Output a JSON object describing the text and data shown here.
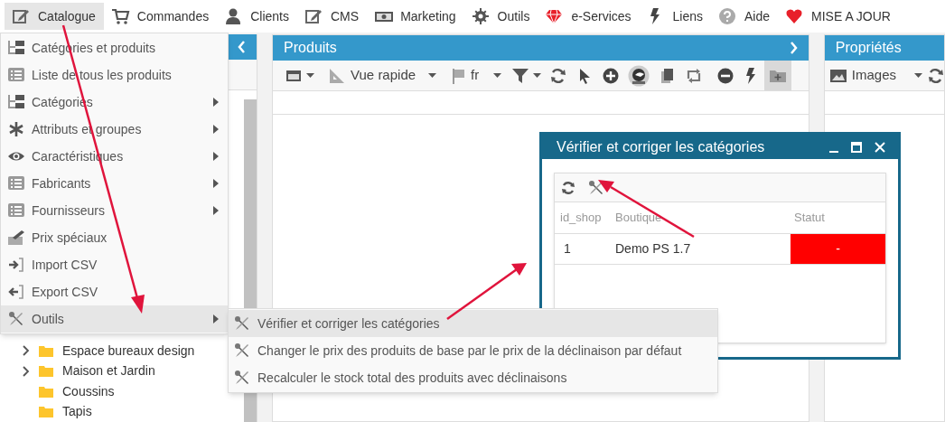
{
  "menubar": [
    {
      "label": "Catalogue",
      "selected": true
    },
    {
      "label": "Commandes",
      "selected": false
    },
    {
      "label": "Clients",
      "selected": false
    },
    {
      "label": "CMS",
      "selected": false
    },
    {
      "label": "Marketing",
      "selected": false
    },
    {
      "label": "Outils",
      "selected": false
    },
    {
      "label": "e-Services",
      "selected": false
    },
    {
      "label": "Liens",
      "selected": false
    },
    {
      "label": "Aide",
      "selected": false
    },
    {
      "label": "MISE A JOUR",
      "selected": false
    }
  ],
  "catalogue_menu": [
    {
      "label": "Catégories et produits",
      "submenu": false,
      "selected": false
    },
    {
      "label": "Liste de tous les produits",
      "submenu": false,
      "selected": false
    },
    {
      "label": "Catégories",
      "submenu": true,
      "selected": false
    },
    {
      "label": "Attributs et groupes",
      "submenu": true,
      "selected": false
    },
    {
      "label": "Caractéristiques",
      "submenu": true,
      "selected": false
    },
    {
      "label": "Fabricants",
      "submenu": true,
      "selected": false
    },
    {
      "label": "Fournisseurs",
      "submenu": true,
      "selected": false
    },
    {
      "label": "Prix spéciaux",
      "submenu": false,
      "selected": false
    },
    {
      "label": "Import CSV",
      "submenu": false,
      "selected": false
    },
    {
      "label": "Export CSV",
      "submenu": false,
      "selected": false
    },
    {
      "label": "Outils",
      "submenu": true,
      "selected": true
    }
  ],
  "outils_submenu": [
    {
      "label": "Vérifier et corriger les catégories",
      "selected": true
    },
    {
      "label": "Changer le prix des produits de base par le prix de la déclinaison par défaut",
      "selected": false
    },
    {
      "label": "Recalculer le stock total des produits avec déclinaisons",
      "selected": false
    }
  ],
  "category_tree": [
    {
      "label": "Espace bureaux design",
      "expandable": true
    },
    {
      "label": "Maison et Jardin",
      "expandable": true
    },
    {
      "label": "Coussins",
      "expandable": false
    },
    {
      "label": "Tapis",
      "expandable": false
    }
  ],
  "products_panel": {
    "title": "Produits",
    "view_label": "Vue rapide",
    "language": "fr",
    "add_folder_pressed": true
  },
  "properties_panel": {
    "title": "Propriétés",
    "images_label": "Images"
  },
  "dialog": {
    "title": "Vérifier et corriger les catégories",
    "columns": [
      "id_shop",
      "Boutique",
      "Statut"
    ],
    "rows": [
      {
        "id_shop": "1",
        "boutique": "Demo PS 1.7",
        "statut": "-",
        "color": "#ff0000"
      }
    ]
  }
}
